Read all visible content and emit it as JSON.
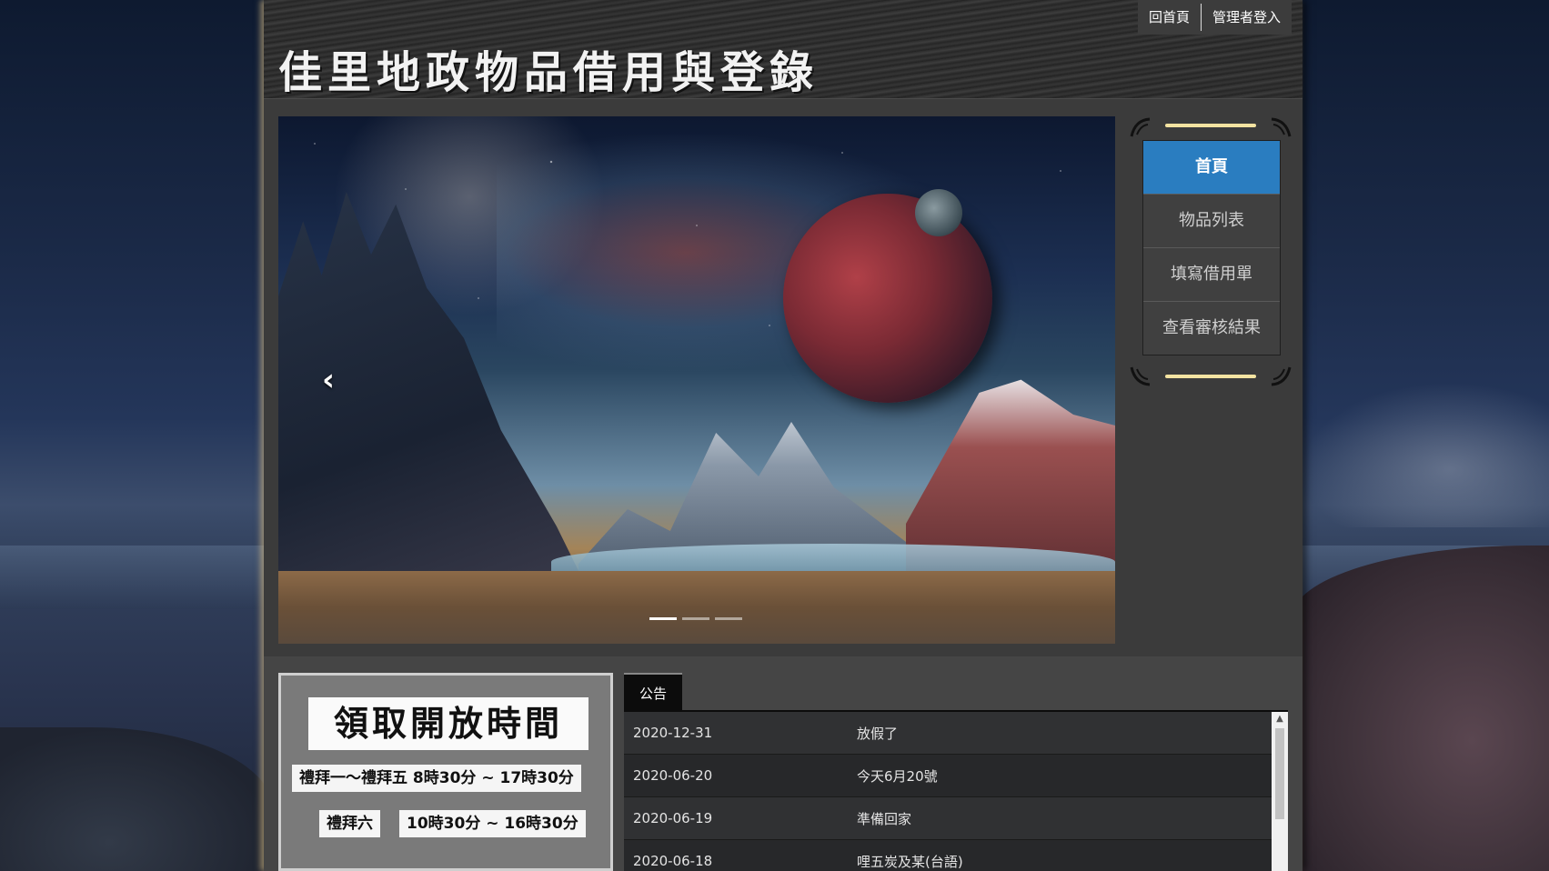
{
  "site": {
    "title": "佳里地政物品借用與登錄",
    "top_links": [
      "回首頁",
      "管理者登入"
    ]
  },
  "banner": {
    "prev_label": "‹",
    "indicator_count": 3,
    "active_index": 0
  },
  "nav": {
    "items": [
      {
        "label": "首頁",
        "active": true
      },
      {
        "label": "物品列表",
        "active": false
      },
      {
        "label": "填寫借用單",
        "active": false
      },
      {
        "label": "查看審核結果",
        "active": false
      }
    ]
  },
  "hours": {
    "title": "領取開放時間",
    "weekday": "禮拜一～禮拜五  8時30分 ~ 17時30分",
    "saturday_label": "禮拜六",
    "saturday_time": "10時30分 ~ 16時30分"
  },
  "announcements": {
    "tab_label": "公告",
    "rows": [
      {
        "date": "2020-12-31",
        "text": "放假了"
      },
      {
        "date": "2020-06-20",
        "text": "今天6月20號"
      },
      {
        "date": "2020-06-19",
        "text": "準備回家"
      },
      {
        "date": "2020-06-18",
        "text": "哩五炭及某(台語)"
      }
    ]
  },
  "colors": {
    "nav_active": "#2a7dc0",
    "rail": "#f3e3a1",
    "tab_bg": "#0c0c0c"
  }
}
